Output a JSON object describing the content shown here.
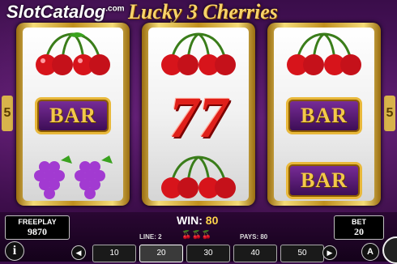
{
  "logo": {
    "brand": "SlotCatalog",
    "suffix": ".com"
  },
  "game_title": "Lucky 3 Cherries",
  "reels": [
    {
      "symbols": [
        "cherries",
        "bar",
        "grapes"
      ]
    },
    {
      "symbols": [
        "cherries",
        "sevens",
        "cherries"
      ]
    },
    {
      "symbols": [
        "cherries",
        "bar",
        "bar"
      ]
    }
  ],
  "bar_label": "BAR",
  "sevens_label": "77",
  "side_marks": {
    "left": "5",
    "right": "5"
  },
  "freeplay": {
    "label": "FREEPLAY",
    "value": "9870"
  },
  "bet": {
    "label": "BET",
    "value": "20"
  },
  "win": {
    "label": "WIN:",
    "value": "80"
  },
  "line": {
    "label": "LINE: 2"
  },
  "pays": {
    "label": "PAYS: 80"
  },
  "bet_options": [
    "10",
    "20",
    "30",
    "40",
    "50"
  ],
  "selected_bet": "20",
  "controls": {
    "info": "i",
    "auto": "A"
  },
  "colors": {
    "accent": "#ffd54a",
    "bar_purple": "#5a1a6e",
    "cherry_red": "#d7141b"
  }
}
